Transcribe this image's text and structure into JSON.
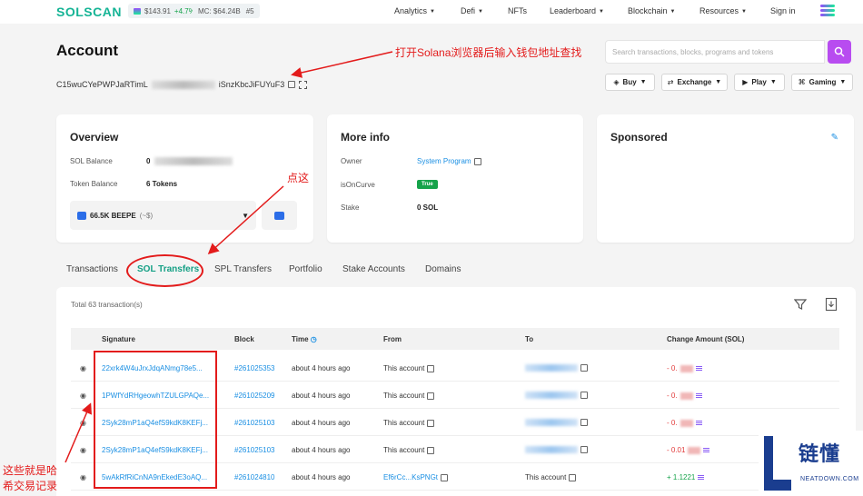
{
  "nav": {
    "logo": "SOLSCAN",
    "price": "$143.91",
    "change": "+4.7%",
    "market_cap": "MC: $64.24B",
    "rank": "#5",
    "items": [
      "Analytics",
      "Defi",
      "NFTs",
      "Leaderboard",
      "Blockchain",
      "Resources",
      "Sign in"
    ]
  },
  "account": {
    "title": "Account",
    "address_start": "C15wuCYePWPJaRTimL",
    "address_end": "iSnzKbcJiFUYuF3"
  },
  "search": {
    "placeholder": "Search transactions, blocks, programs and tokens"
  },
  "actions": {
    "buy": "Buy",
    "exchange": "Exchange",
    "play": "Play",
    "gaming": "Gaming"
  },
  "overview": {
    "title": "Overview",
    "sol_balance_label": "SOL Balance",
    "sol_balance_value": "0",
    "token_balance_label": "Token Balance",
    "token_balance_value": "6 Tokens",
    "token_select": "66.5K BEEPE",
    "token_select_usd": "(~$)"
  },
  "more_info": {
    "title": "More info",
    "owner_label": "Owner",
    "owner_value": "System Program",
    "on_curve_label": "isOnCurve",
    "on_curve_value": "True",
    "stake_label": "Stake",
    "stake_value": "0 SOL"
  },
  "sponsored": {
    "title": "Sponsored"
  },
  "tabs": [
    "Transactions",
    "SOL Transfers",
    "SPL Transfers",
    "Portfolio",
    "Stake Accounts",
    "Domains"
  ],
  "table": {
    "total": "Total 63 transaction(s)",
    "headers": {
      "signature": "Signature",
      "block": "Block",
      "time": "Time",
      "from": "From",
      "to": "To",
      "amount": "Change Amount (SOL)"
    },
    "rows": [
      {
        "signature": "22xrk4W4uJrxJdqANmg78e5...",
        "block": "#261025353",
        "time": "about 4 hours ago",
        "from": "This account",
        "to": "",
        "amount": "- 0."
      },
      {
        "signature": "1PWfYdRHgeowhTZULGPAQe...",
        "block": "#261025209",
        "time": "about 4 hours ago",
        "from": "This account",
        "to": "",
        "amount": "- 0."
      },
      {
        "signature": "2Syk28mP1aQ4efS9kdK8KEFj...",
        "block": "#261025103",
        "time": "about 4 hours ago",
        "from": "This account",
        "to": "",
        "amount": "- 0."
      },
      {
        "signature": "2Syk28mP1aQ4efS9kdK8KEFj...",
        "block": "#261025103",
        "time": "about 4 hours ago",
        "from": "This account",
        "to": "",
        "amount": "- 0.01"
      },
      {
        "signature": "5wAkRfRiCnNA9nEkedE3oAQ...",
        "block": "#261024810",
        "time": "about 4 hours ago",
        "from": "Ef6rCc...KsPNGt",
        "to": "This account",
        "amount": "+ 1.1221"
      }
    ]
  },
  "annotations": {
    "search_hint": "打开Solana浏览器后输入钱包地址查找",
    "click_here": "点这",
    "records_line1": "这些就是哈",
    "records_line2": "希交易记录"
  },
  "watermark": {
    "title": "链懂",
    "subtitle": "NEATDOWN.COM"
  }
}
